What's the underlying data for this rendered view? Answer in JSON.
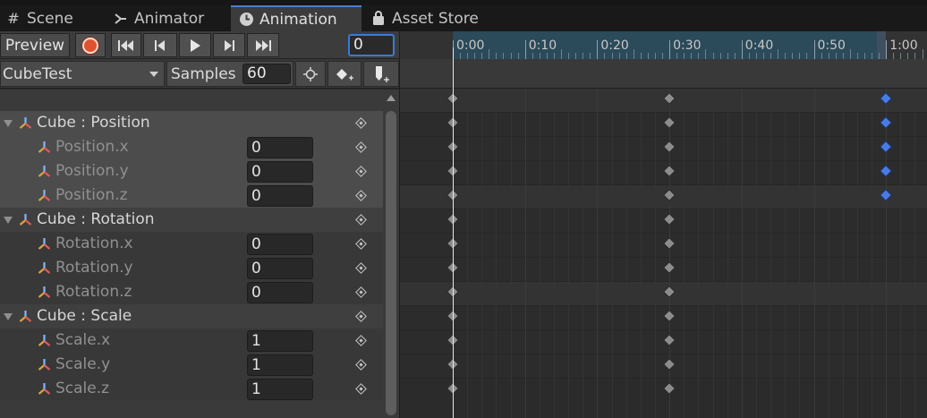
{
  "tabs": [
    {
      "label": "Scene",
      "icon": "grid-icon"
    },
    {
      "label": "Animator",
      "icon": "animator-icon"
    },
    {
      "label": "Animation",
      "icon": "clock-icon",
      "active": true
    },
    {
      "label": "Asset Store",
      "icon": "bag-icon"
    }
  ],
  "toolbar": {
    "preview_label": "Preview",
    "current_frame": "0",
    "clip_name": "CubeTest",
    "samples_label": "Samples",
    "samples_value": "60"
  },
  "timeline": {
    "ticks": [
      "0:00",
      "0:10",
      "0:20",
      "0:30",
      "0:40",
      "0:50",
      "1:00"
    ]
  },
  "properties": [
    {
      "type": "group",
      "label": "Cube : Position",
      "highlighted": true
    },
    {
      "type": "child",
      "label": "Position.x",
      "value": "0",
      "highlighted": true
    },
    {
      "type": "child",
      "label": "Position.y",
      "value": "0",
      "highlighted": true
    },
    {
      "type": "child",
      "label": "Position.z",
      "value": "0",
      "highlighted": true
    },
    {
      "type": "group",
      "label": "Cube : Rotation"
    },
    {
      "type": "child",
      "label": "Rotation.x",
      "value": "0"
    },
    {
      "type": "child",
      "label": "Rotation.y",
      "value": "0"
    },
    {
      "type": "child",
      "label": "Rotation.z",
      "value": "0"
    },
    {
      "type": "group",
      "label": "Cube : Scale"
    },
    {
      "type": "child",
      "label": "Scale.x",
      "value": "1"
    },
    {
      "type": "child",
      "label": "Scale.y",
      "value": "1"
    },
    {
      "type": "child",
      "label": "Scale.z",
      "value": "1"
    }
  ],
  "keyframes": {
    "summary": [
      {
        "frame": 0
      },
      {
        "frame": 30
      },
      {
        "frame": 60,
        "selected": true
      }
    ],
    "position": [
      {
        "frame": 0
      },
      {
        "frame": 30
      },
      {
        "frame": 60,
        "selected": true
      }
    ],
    "rotation": [
      {
        "frame": 0
      },
      {
        "frame": 30
      }
    ],
    "scale": [
      {
        "frame": 0
      },
      {
        "frame": 30
      }
    ]
  },
  "colors": {
    "accent": "#3a7bd5",
    "record": "#e2512f",
    "selected_key": "#4a7be0"
  }
}
